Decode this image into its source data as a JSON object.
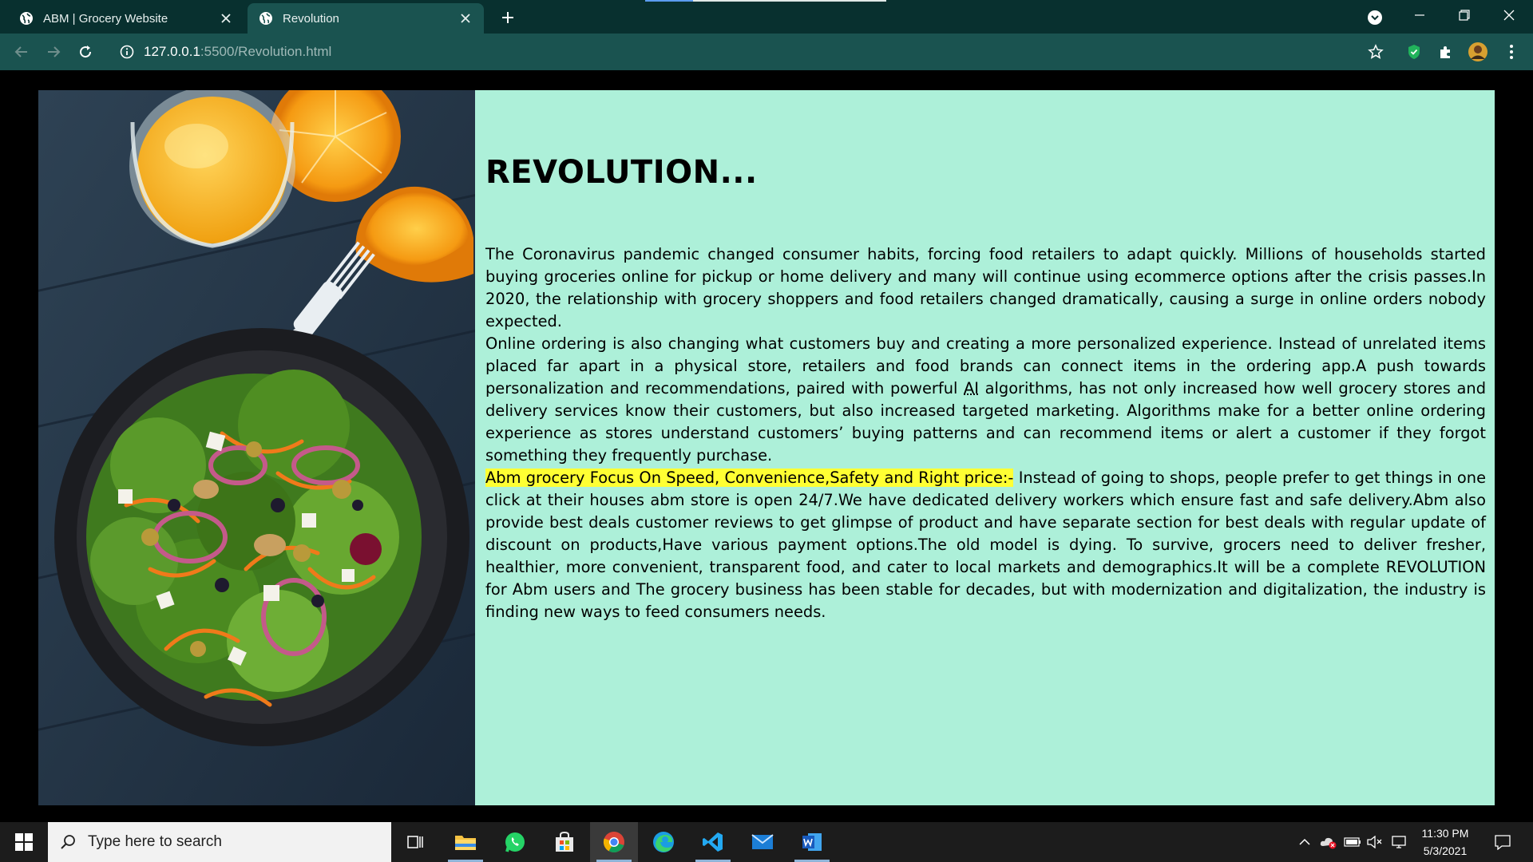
{
  "browser": {
    "tabs": [
      {
        "title": "ABM | Grocery Website",
        "active": false
      },
      {
        "title": "Revolution",
        "active": true
      }
    ],
    "url_host": "127.0.0.1",
    "url_path": ":5500/Revolution.html"
  },
  "page": {
    "title": "REVOLUTION...",
    "para1": "The Coronavirus pandemic changed consumer habits, forcing food retailers to adapt quickly. Millions of households started buying groceries online for pickup or home delivery and many will continue using ecommerce options after the crisis passes.In 2020, the relationship with grocery shoppers and food retailers changed dramatically, causing a surge in online orders nobody expected.",
    "para2_before": "Online ordering is also changing what customers buy and creating a more personalized experience. Instead of unrelated items placed far apart in a physical store, retailers and food brands can connect items in the ordering app.A push towards personalization and recommendations, paired with powerful ",
    "para2_abbr": "AI",
    "para2_after": " algorithms, has not only increased how well grocery stores and delivery services know their customers, but also increased targeted marketing. Algorithms make for a better online ordering experience as stores understand customers’ buying patterns and can recommend items or alert a customer if they forgot something they frequently purchase.",
    "para3_highlight": "Abm grocery Focus On Speed, Convenience,Safety and Right price:-",
    "para3_rest": " Instead of going to shops, people prefer to get things in one click at their houses abm store is open 24/7.We have dedicated delivery workers which ensure fast and safe delivery.Abm also provide best deals customer reviews to get glimpse of product and have separate section for best deals with regular update of discount on products,Have various payment options.The old model is dying. To survive, grocers need to deliver fresher, healthier, more convenient, transparent food, and cater to local markets and demographics.It will be a complete REVOLUTION for Abm users and The grocery business has been stable for decades, but with modernization and digitalization, the industry is finding new ways to feed consumers needs.",
    "highlight_color": "#ffff33",
    "panel_color": "#adf0d9"
  },
  "taskbar": {
    "search_placeholder": "Type here to search",
    "time": "11:30 PM",
    "date": "5/3/2021",
    "apps": [
      "task-view",
      "file-explorer",
      "whatsapp",
      "microsoft-store",
      "chrome",
      "edge",
      "vscode",
      "mail",
      "word"
    ]
  },
  "colors": {
    "tabbar": "#08302f",
    "toolbar": "#1a5350",
    "taskbar": "#1c1c1c"
  }
}
